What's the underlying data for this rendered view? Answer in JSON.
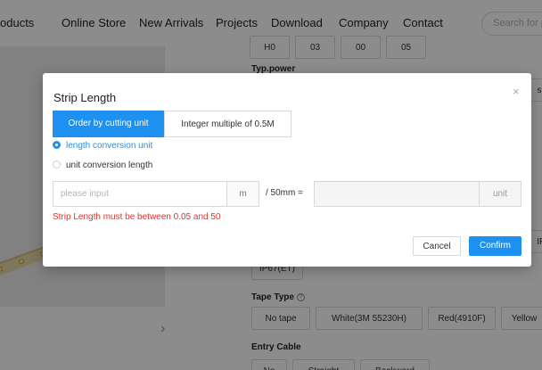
{
  "nav": {
    "items": [
      "oducts",
      "Online Store",
      "New Arrivals",
      "Projects",
      "Download",
      "Company",
      "Contact"
    ],
    "search_placeholder": "Search for pr"
  },
  "specs": {
    "top_row": [
      "H0",
      "03",
      "00",
      "05"
    ],
    "typ_power_label": "Typ.power",
    "typ_power_partial": "s",
    "ip_partial": "IP",
    "ip_option": "IP67(ET)",
    "tape_type_label": "Tape Type",
    "tape_type_options": [
      "No tape",
      "White(3M 55230H)",
      "Red(4910F)",
      "Yellow"
    ],
    "entry_cable_label": "Entry Cable",
    "entry_cable_options": [
      "No",
      "Straight",
      "Backward"
    ]
  },
  "modal": {
    "title": "Strip Length",
    "close": "×",
    "tabs": [
      "Order by cutting unit",
      "Integer multiple of 0.5M"
    ],
    "radios": [
      "length conversion unit",
      "unit conversion length"
    ],
    "input_placeholder": "please input",
    "unit_m": "m",
    "conversion_text": "/ 50mm =",
    "unit_label": "unit",
    "error": "Strip Length must be between 0.05 and 50",
    "cancel": "Cancel",
    "confirm": "Confirm"
  },
  "colors": {
    "accent": "#1e90ef",
    "error": "#e5322d"
  }
}
